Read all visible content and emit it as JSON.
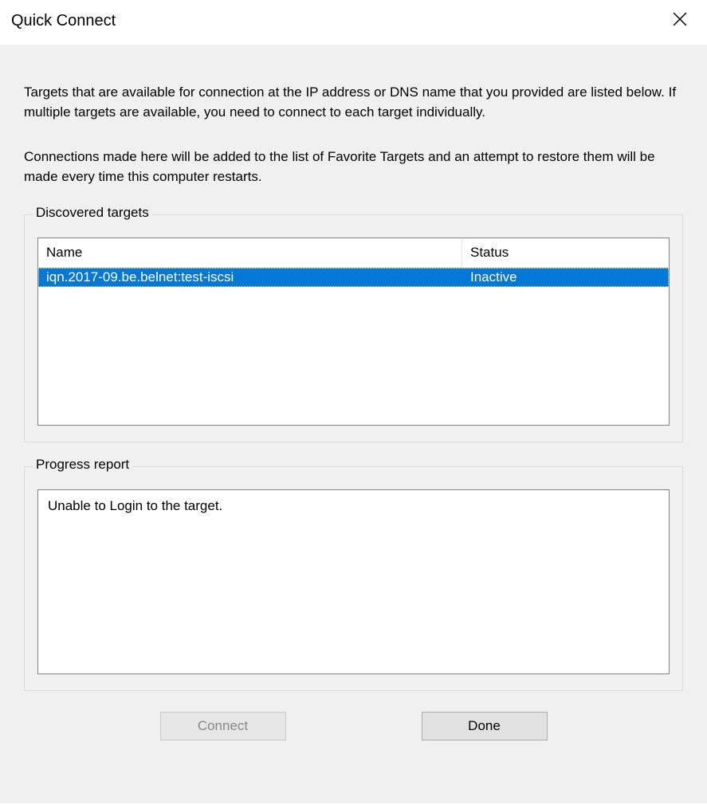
{
  "titlebar": {
    "title": "Quick Connect"
  },
  "description": {
    "para1": "Targets that are available for connection at the IP address or DNS name that you provided are listed below.  If multiple targets are available, you need to connect to each target individually.",
    "para2": "Connections made here will be added to the list of Favorite Targets and an attempt to restore them will be made every time this computer restarts."
  },
  "discovered": {
    "legend": "Discovered targets",
    "columns": {
      "name": "Name",
      "status": "Status"
    },
    "rows": [
      {
        "name": "iqn.2017-09.be.belnet:test-iscsi",
        "status": "Inactive",
        "selected": true
      }
    ]
  },
  "progress": {
    "legend": "Progress report",
    "message": "Unable to Login to the target."
  },
  "buttons": {
    "connect": "Connect",
    "done": "Done"
  }
}
